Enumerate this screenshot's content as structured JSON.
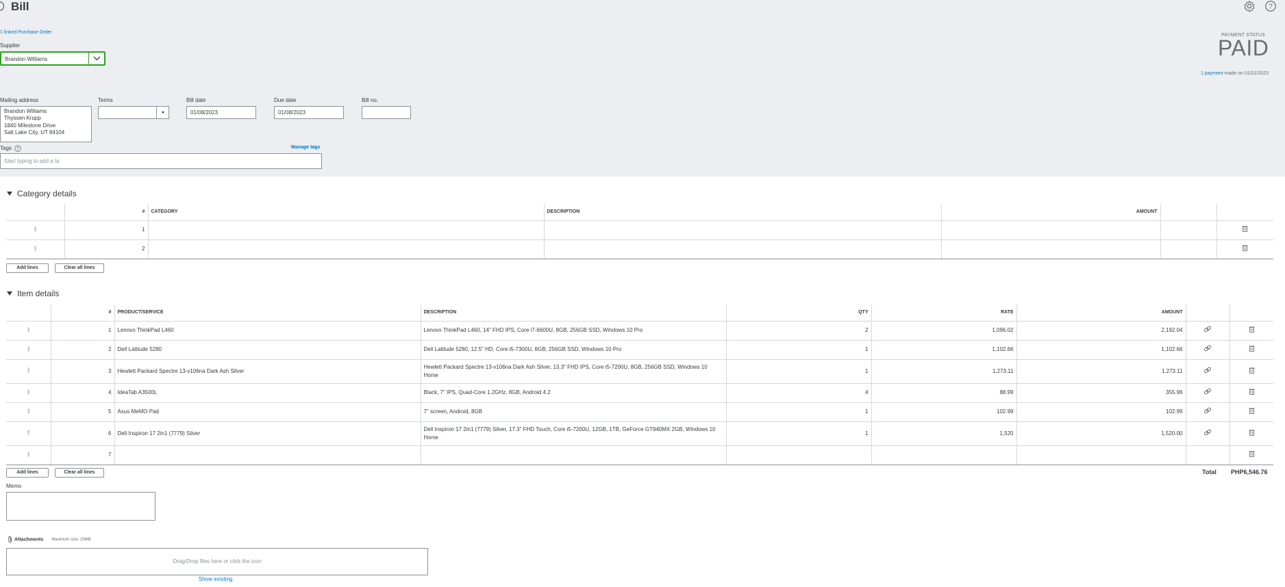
{
  "header": {
    "title": "Bill",
    "settings_icon": "gear-icon",
    "help_icon": "help-icon"
  },
  "linked_po": "1 linked Purchase Order",
  "supplier": {
    "label": "Supplier",
    "value": "Brandon Williams"
  },
  "payment": {
    "status_label": "PAYMENT STATUS",
    "status": "PAID",
    "link_text": "1 payment",
    "note": "made on 01/31/2023"
  },
  "fields": {
    "mailing_address_label": "Mailing address",
    "mailing_address_lines": [
      "Brandon Williams",
      "Thyssen Krupp",
      "1840 Milestone Drive",
      "Salt Lake City, UT 84104"
    ],
    "terms_label": "Terms",
    "terms_value": "",
    "bill_date_label": "Bill date",
    "bill_date_value": "01/08/2023",
    "due_date_label": "Due date",
    "due_date_value": "01/08/2023",
    "bill_no_label": "Bill no.",
    "bill_no_value": ""
  },
  "tags": {
    "label": "Tags",
    "manage": "Manage tags",
    "placeholder": "Start typing to add a ta"
  },
  "category_details": {
    "title": "Category details",
    "columns": [
      "#",
      "CATEGORY",
      "DESCRIPTION",
      "AMOUNT"
    ],
    "rows": [
      {
        "num": "1"
      },
      {
        "num": "2"
      }
    ],
    "add_lines": "Add lines",
    "clear_lines": "Clear all lines"
  },
  "item_details": {
    "title": "Item details",
    "columns": [
      "#",
      "PRODUCT/SERVICE",
      "DESCRIPTION",
      "QTY",
      "RATE",
      "AMOUNT"
    ],
    "rows": [
      {
        "num": "1",
        "product": "Lenovo ThinkPad L460",
        "description": "Lenovo ThinkPad L460, 14\" FHD IPS, Core i7-6600U, 8GB, 256GB SSD, Windows 10 Pro",
        "qty": "2",
        "rate": "1,096.02",
        "amount": "2,192.04"
      },
      {
        "num": "2",
        "product": "Dell Latitude 5280",
        "description": "Dell Latitude 5280, 12.5\" HD, Core i5-7300U, 8GB, 256GB SSD, Windows 10 Pro",
        "qty": "1",
        "rate": "1,102.66",
        "amount": "1,102.66"
      },
      {
        "num": "3",
        "product": "Hewlett Packard Spectre 13-v106na Dark Ash Silver",
        "description": "Hewlett Packard Spectre 13-v106na Dark Ash Silver, 13.3\" FHD IPS, Core i5-7200U, 8GB, 256GB SSD, Windows 10 Home",
        "qty": "1",
        "rate": "1,273.11",
        "amount": "1,273.11"
      },
      {
        "num": "4",
        "product": "IdeaTab A3500L",
        "description": "Black, 7\" IPS, Quad-Core 1.2GHz, 8GB, Android 4.2",
        "qty": "4",
        "rate": "88.99",
        "amount": "355.96"
      },
      {
        "num": "5",
        "product": "Asus MeMO Pad",
        "description": "7\" screen, Android, 8GB",
        "qty": "1",
        "rate": "102.99",
        "amount": "102.99"
      },
      {
        "num": "6",
        "product": "Dell Inspiron 17 2in1 (7779) Silver",
        "description": "Dell Inspiron 17 2in1 (7779) Silver, 17.3\" FHD Touch, Core i5-7200U, 12GB, 1TB, GeForce GT940MX 2GB, Windows 10 Home",
        "qty": "1",
        "rate": "1,520",
        "amount": "1,520.00"
      },
      {
        "num": "7",
        "product": "",
        "description": "",
        "qty": "",
        "rate": "",
        "amount": ""
      }
    ],
    "add_lines": "Add lines",
    "clear_lines": "Clear all lines"
  },
  "total": {
    "label": "Total",
    "value": "PHP6,546.76"
  },
  "memo": {
    "label": "Memo"
  },
  "attachments": {
    "label": "Attachments",
    "max_size": "Maximum size: 20MB",
    "drop_text": "Drag/Drop files here or click the icon",
    "show_existing": "Show existing"
  }
}
